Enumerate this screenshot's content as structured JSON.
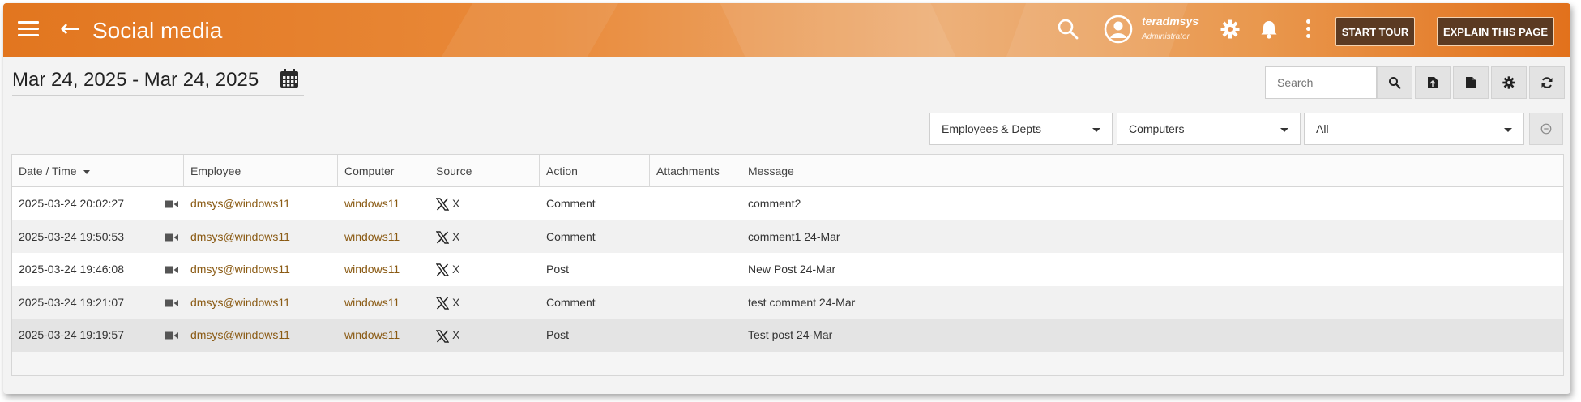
{
  "header": {
    "title": "Social media",
    "user": {
      "name": "teradmsys",
      "role": "Administrator"
    },
    "buttons": {
      "start_tour": "START TOUR",
      "explain_page": "EXPLAIN THIS PAGE"
    },
    "icons": [
      "menu-icon",
      "back-arrow-icon",
      "search-icon",
      "avatar-icon",
      "gear-icon",
      "bell-icon",
      "more-vertical-icon"
    ],
    "colors": {
      "bar_start": "#e2761f",
      "bar_end": "#e2711c",
      "button_bg": "#5b3a22"
    }
  },
  "date_range": "Mar 24, 2025 - Mar 24, 2025",
  "toolbar": {
    "search_placeholder": "Search",
    "icons": [
      "search-icon",
      "export-file-icon",
      "document-icon",
      "settings-icon",
      "refresh-icon"
    ]
  },
  "filters": {
    "employees": "Employees & Depts",
    "computers": "Computers",
    "source": "All"
  },
  "table": {
    "columns": [
      "Date / Time",
      "Employee",
      "Computer",
      "Source",
      "Action",
      "Attachments",
      "Message"
    ],
    "rows": [
      {
        "datetime": "2025-03-24 20:02:27",
        "employee": "dmsys@windows11",
        "computer": "windows11",
        "source": "X",
        "action": "Comment",
        "attachments": "",
        "message": "comment2"
      },
      {
        "datetime": "2025-03-24 19:50:53",
        "employee": "dmsys@windows11",
        "computer": "windows11",
        "source": "X",
        "action": "Comment",
        "attachments": "",
        "message": "comment1 24-Mar"
      },
      {
        "datetime": "2025-03-24 19:46:08",
        "employee": "dmsys@windows11",
        "computer": "windows11",
        "source": "X",
        "action": "Post",
        "attachments": "",
        "message": "New Post 24-Mar"
      },
      {
        "datetime": "2025-03-24 19:21:07",
        "employee": "dmsys@windows11",
        "computer": "windows11",
        "source": "X",
        "action": "Comment",
        "attachments": "",
        "message": "test comment 24-Mar"
      },
      {
        "datetime": "2025-03-24 19:19:57",
        "employee": "dmsys@windows11",
        "computer": "windows11",
        "source": "X",
        "action": "Post",
        "attachments": "",
        "message": "Test post 24-Mar"
      }
    ],
    "link_color": "#8a5a13"
  }
}
